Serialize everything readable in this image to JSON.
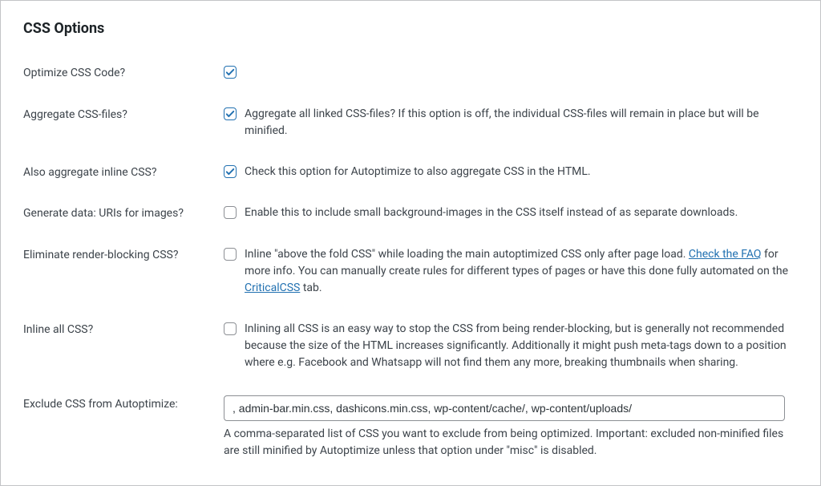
{
  "section_title": "CSS Options",
  "options": {
    "optimize_css": {
      "label": "Optimize CSS Code?",
      "desc": ""
    },
    "aggregate_css": {
      "label": "Aggregate CSS-files?",
      "desc": "Aggregate all linked CSS-files? If this option is off, the individual CSS-files will remain in place but will be minified."
    },
    "aggregate_inline": {
      "label": "Also aggregate inline CSS?",
      "desc": "Check this option for Autoptimize to also aggregate CSS in the HTML."
    },
    "data_uris": {
      "label": "Generate data: URIs for images?",
      "desc": "Enable this to include small background-images in the CSS itself instead of as separate downloads."
    },
    "render_blocking": {
      "label": "Eliminate render-blocking CSS?",
      "desc_part1": "Inline \"above the fold CSS\" while loading the main autoptimized CSS only after page load. ",
      "link1": "Check the FAQ",
      "desc_part2": " for more info. You can manually create rules for different types of pages or have this done fully automated on the ",
      "link2": "CriticalCSS",
      "desc_part3": " tab."
    },
    "inline_all": {
      "label": "Inline all CSS?",
      "desc": "Inlining all CSS is an easy way to stop the CSS from being render-blocking, but is generally not recommended because the size of the HTML increases significantly. Additionally it might push meta-tags down to a position where e.g. Facebook and Whatsapp will not find them any more, breaking thumbnails when sharing."
    },
    "exclude": {
      "label": "Exclude CSS from Autoptimize:",
      "value": ", admin-bar.min.css, dashicons.min.css, wp-content/cache/, wp-content/uploads/",
      "helper": "A comma-separated list of CSS you want to exclude from being optimized. Important: excluded non-minified files are still minified by Autoptimize unless that option under \"misc\" is disabled."
    }
  },
  "colors": {
    "link": "#2271b1",
    "text": "#3c434a",
    "border": "#c3c4c7"
  }
}
